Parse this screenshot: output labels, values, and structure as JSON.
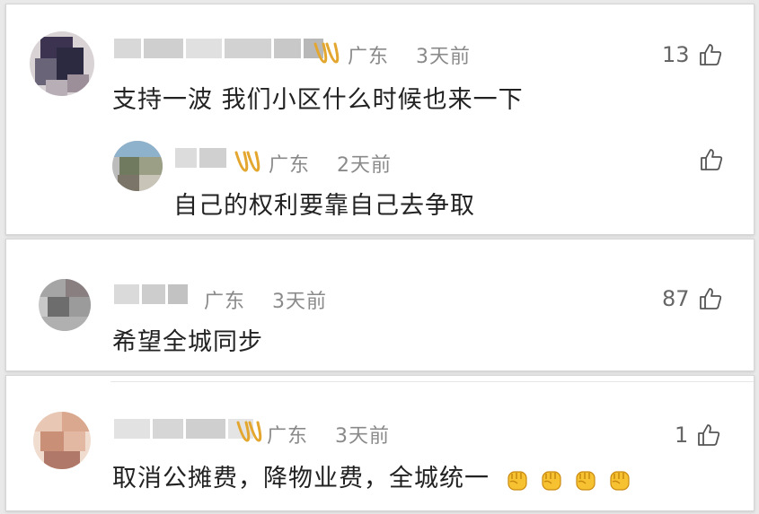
{
  "colors": {
    "meta_text": "#8a8a8a",
    "content_text": "#222222",
    "vip_gold": "#e3a62f",
    "emoji_yellow": "#f7c232"
  },
  "comments": [
    {
      "location": "广东",
      "time": "3天前",
      "text": "支持一波 我们小区什么时候也来一下",
      "likes": "13",
      "reply": {
        "location": "广东",
        "time": "2天前",
        "text": "自己的权利要靠自己去争取"
      }
    },
    {
      "location": "广东",
      "time": "3天前",
      "text": "希望全城同步",
      "likes": "87"
    },
    {
      "location": "广东",
      "time": "3天前",
      "text": "取消公摊费，降物业费，全城统一",
      "likes": "1",
      "emojis": [
        "raised-fist-emoji",
        "raised-fist-emoji",
        "raised-fist-emoji",
        "raised-fist-emoji"
      ]
    }
  ],
  "icons": {
    "like": "thumbs-up-icon",
    "vip": "vip-badge-icon"
  }
}
